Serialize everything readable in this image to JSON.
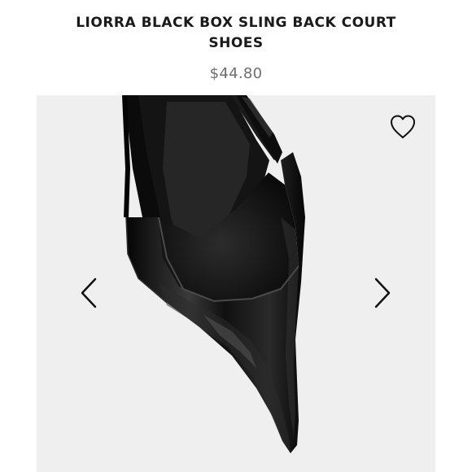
{
  "product": {
    "title": "LIORRA BLACK BOX SLING BACK COURT SHOES",
    "price": "$44.80"
  },
  "gallery": {
    "background_color": "#efefef",
    "prev_icon": "chevron-left-icon",
    "next_icon": "chevron-right-icon",
    "favorite_icon": "heart-outline-icon"
  },
  "colors": {
    "title": "#1a1a1a",
    "price": "#6e6e6e",
    "shoe": "#0d0d0d"
  }
}
